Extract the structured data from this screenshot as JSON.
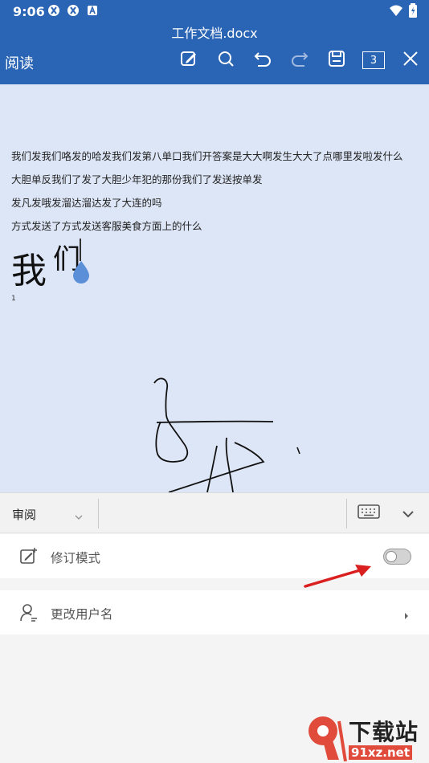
{
  "status_bar": {
    "time": "9:06"
  },
  "app_bar": {
    "doc_title": "工作文档.docx",
    "read_mode_label": "阅读",
    "page_count": "3"
  },
  "document": {
    "lines": [
      "我们发我们咯发的哈发我们发第八单口我们开答案是大大啊发生大大了点哪里发啦发什么",
      "大胆单反我们了发了大胆少年犯的那份我们了发送按单发",
      "发凡发哦发溜达溜达发了大连的吗",
      "方式发送了方式发送客服美食方面上的什么"
    ],
    "large_text_1": "我",
    "large_text_2": "们",
    "small_marker": "1"
  },
  "review_panel": {
    "tab_label": "审阅",
    "revision_mode_label": "修订模式",
    "revision_mode_on": false,
    "change_username_label": "更改用户名"
  },
  "watermark": {
    "title": "下载站",
    "url": "91xz.net"
  },
  "colors": {
    "app_bar": "#2a64b4",
    "document_bg": "#dde6f6",
    "annotation_arrow": "#d91f1f"
  }
}
